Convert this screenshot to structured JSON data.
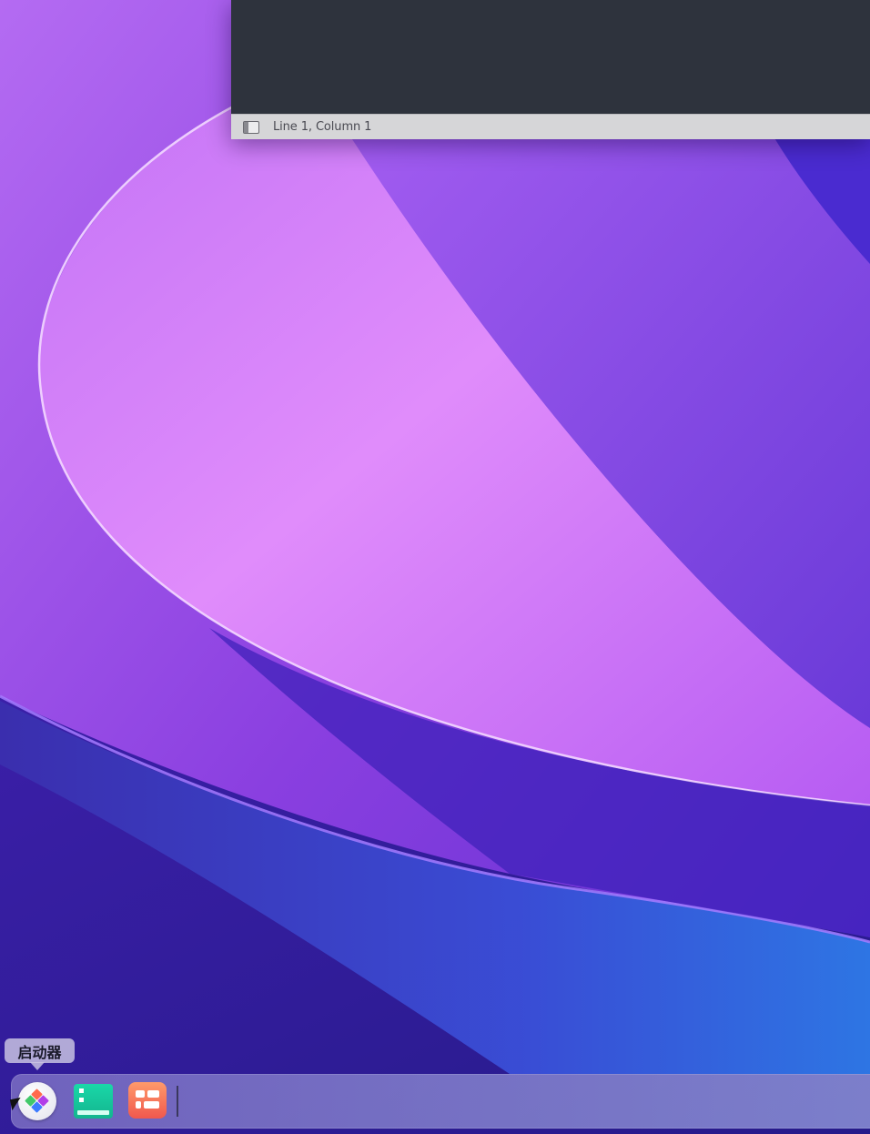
{
  "editor": {
    "status": "Line 1, Column 1"
  },
  "dock": {
    "tooltip": "启动器",
    "items": [
      {
        "name": "launcher",
        "icon": "launcher-icon"
      },
      {
        "name": "terminal",
        "icon": "terminal-icon"
      },
      {
        "name": "app-store",
        "icon": "app-grid-icon"
      }
    ]
  },
  "colors": {
    "editor_background": "#2e333d",
    "statusbar_background": "#d6d6d8",
    "terminal_icon": "#13b58f",
    "app_icon": "#f0584e"
  }
}
